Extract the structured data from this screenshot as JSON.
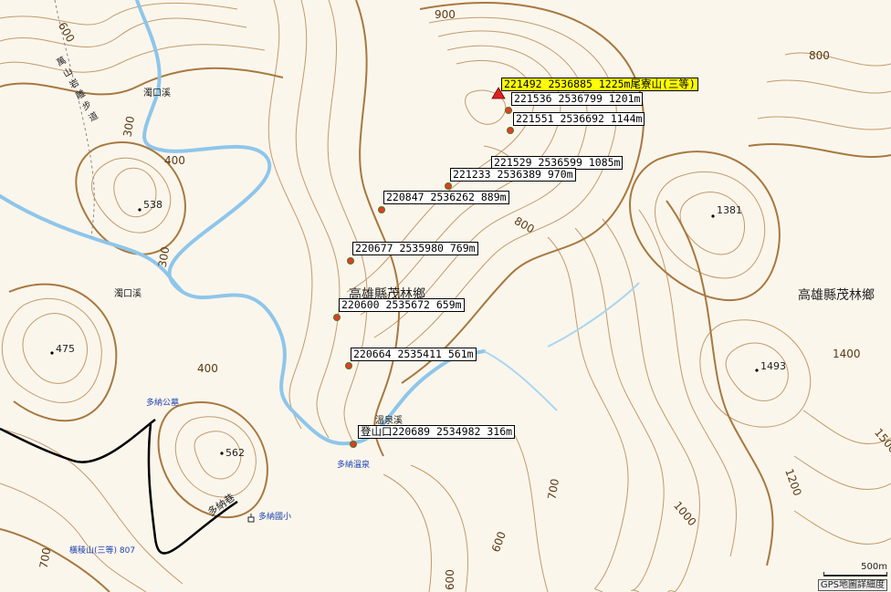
{
  "peak": {
    "label": "221492 2536885 1225m尾寮山(三等)"
  },
  "waypoints": [
    {
      "label": "221536 2536799 1201m"
    },
    {
      "label": "221551 2536692 1144m"
    },
    {
      "label": "221529 2536599 1085m"
    },
    {
      "label": "221233 2536389 970m"
    },
    {
      "label": "220847 2536262 889m"
    },
    {
      "label": "220677 2535980 769m"
    },
    {
      "label": "220600 2535672 659m"
    },
    {
      "label": "220664 2535411 561m"
    },
    {
      "label": "登山口220689 2534982 316m"
    }
  ],
  "places": {
    "town_1": "高雄縣茂林鄉",
    "town_2": "高雄縣茂林鄉",
    "trail": "萬山岩雕步道",
    "stream_1": "濁口溪",
    "stream_2": "濁口溪",
    "hot_spring_stream": "溫泉溪",
    "duona_park": "多納公墓",
    "duona_hot_spring": "多納溫泉",
    "duona_road": "多納巷",
    "duona_school": "多納國小",
    "mountain": "橫稜山(三等) 807"
  },
  "spot_heights": [
    "538",
    "475",
    "562",
    "1381",
    "1493"
  ],
  "contour_labels": [
    "600",
    "900",
    "800",
    "300",
    "400",
    "300",
    "800",
    "400",
    "1400",
    "1500",
    "1200",
    "1000",
    "700",
    "600",
    "700",
    "600"
  ],
  "scale": {
    "distance": "500m",
    "caption": "GPS地圖詳細度"
  },
  "colors": {
    "background": "#fbf6ec",
    "contour": "#b0834f",
    "river": "#8ec6ea",
    "peak_highlight": "#ffff00"
  }
}
